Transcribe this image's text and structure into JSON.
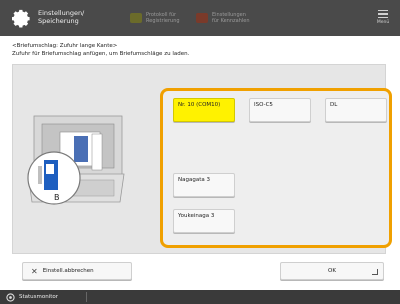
{
  "header": {
    "title": "Einstellungen/ Speicherung",
    "tabs": [
      {
        "label": "Protokoll für Registrierung"
      },
      {
        "label": "Einstellungen für Kennzahlen"
      }
    ],
    "menu_label": "Menü"
  },
  "instructions": {
    "line1": "<Briefumschlag: Zufuhr lange Kante>",
    "line2": "Zufuhr für Briefumschlag anfügen, um Briefumschläge zu laden."
  },
  "envelope_options": [
    {
      "label": "Nr. 10 (COM10)",
      "selected": true
    },
    {
      "label": "ISO-C5",
      "selected": false
    },
    {
      "label": "DL",
      "selected": false
    },
    {
      "label": "Nagagata 3",
      "selected": false
    },
    {
      "label": "Youkeinaga 3",
      "selected": false
    }
  ],
  "illustration_label": "B",
  "footer": {
    "cancel_label": "Einstell.abbrechen",
    "ok_label": "OK"
  },
  "status_bar": {
    "label": "Statusmonitor"
  },
  "colors": {
    "accent_frame": "#f0a000",
    "selected_button": "#fff200",
    "header_bg": "#4a4a4a"
  }
}
